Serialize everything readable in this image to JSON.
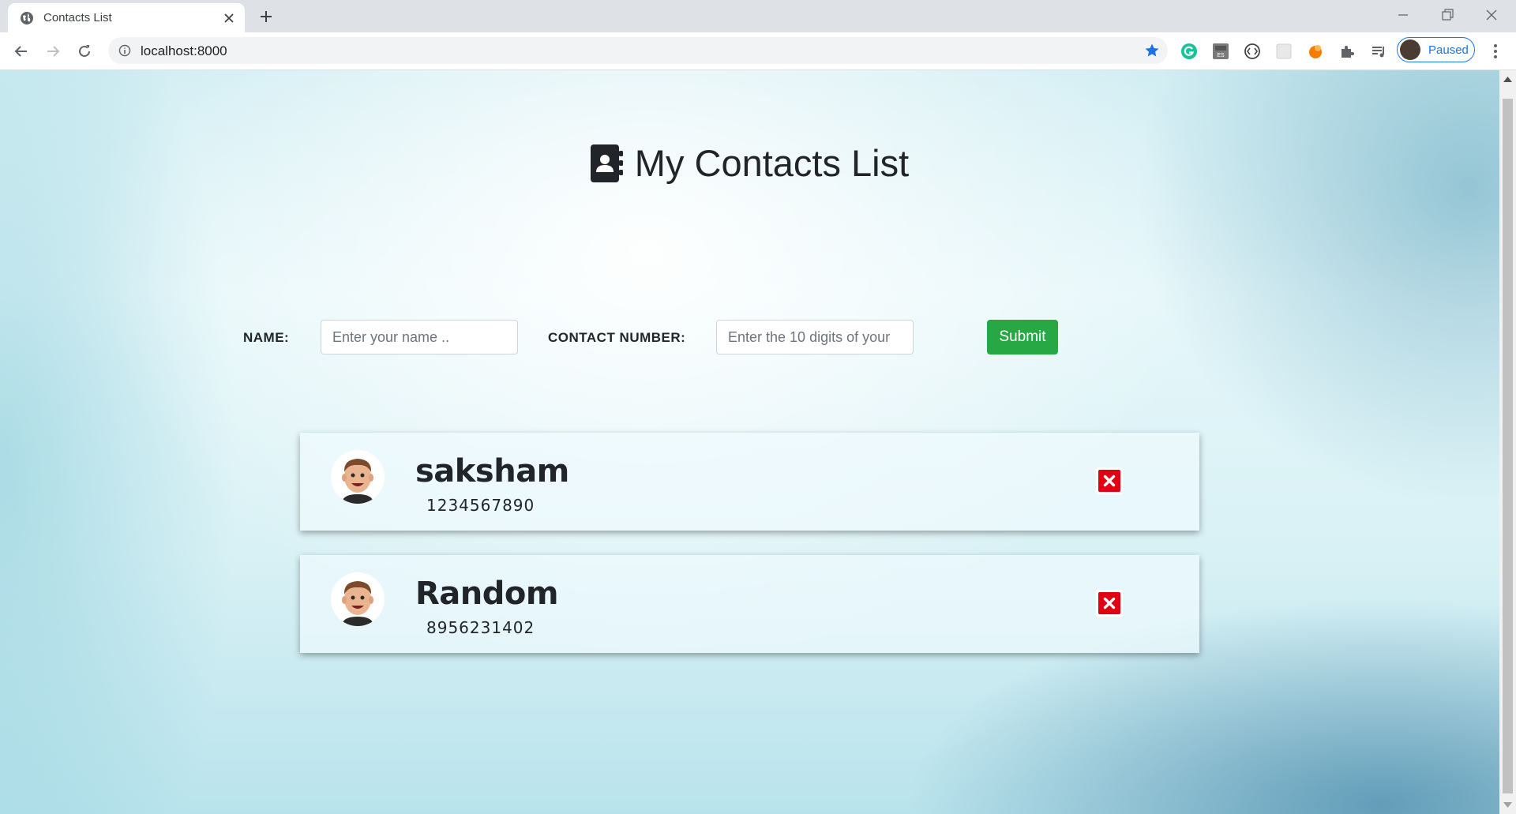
{
  "browser": {
    "tab_title": "Contacts List",
    "url": "localhost:8000",
    "profile_status": "Paused"
  },
  "page": {
    "title": "My Contacts List",
    "form": {
      "name_label": "NAME:",
      "name_placeholder": "Enter your name ..",
      "contact_label": "CONTACT NUMBER:",
      "contact_placeholder": "Enter the 10 digits of your",
      "submit_label": "Submit"
    },
    "contacts": [
      {
        "name": "saksham",
        "phone": "1234567890"
      },
      {
        "name": "Random",
        "phone": "8956231402"
      }
    ]
  },
  "icons": {
    "heading_icon": "address-book-icon",
    "delete_icon": "delete-x-icon",
    "avatar_icon": "cartoon-face-avatar"
  },
  "colors": {
    "submit_button": "#28a745",
    "delete_button": "#e00012",
    "heading_text": "#212529",
    "bookmark_star": "#1a73e8"
  }
}
